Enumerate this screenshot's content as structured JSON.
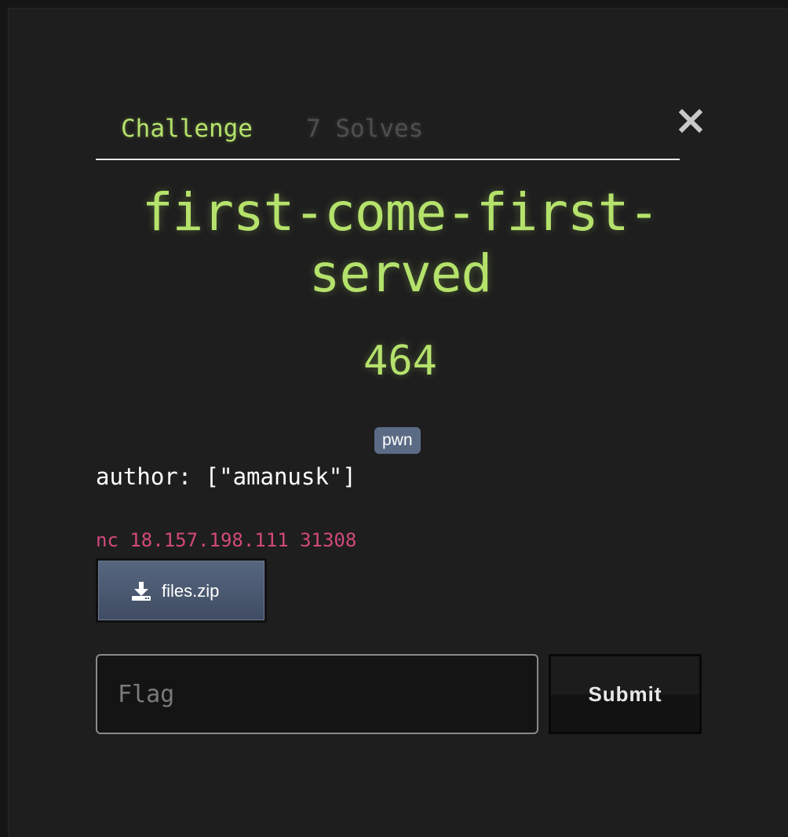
{
  "tabs": {
    "challenge": "Challenge",
    "solves": "7 Solves"
  },
  "challenge": {
    "name": "first-come-first-served",
    "points": "464",
    "tag": "pwn",
    "description": "author: [\"amanusk\"]",
    "connection": "nc 18.157.198.111 31308"
  },
  "files": [
    {
      "label": "files.zip",
      "icon": "download-icon"
    }
  ],
  "form": {
    "flag_placeholder": "Flag",
    "flag_value": "",
    "submit_label": "Submit"
  },
  "icons": {
    "close": "close-icon",
    "download": "download-icon"
  },
  "colors": {
    "accent_green": "#b5e26b",
    "connection_pink": "#d2497b",
    "tag_bg": "#5c6b85",
    "background": "#1e1e1e"
  }
}
